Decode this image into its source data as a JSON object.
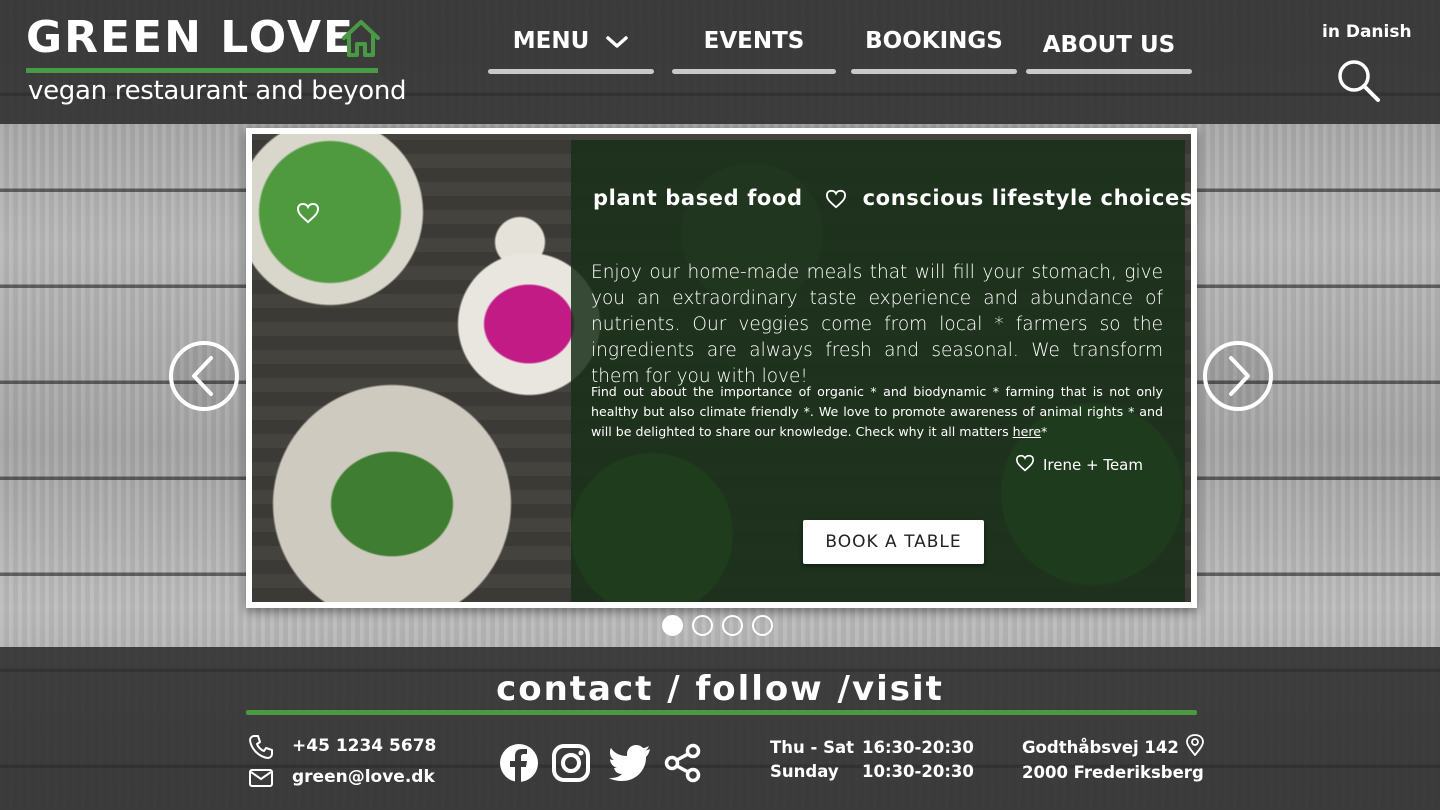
{
  "header": {
    "logo_title": "GREEN LOVE",
    "logo_subtitle": "vegan restaurant and beyond",
    "nav": [
      {
        "label": "MENU"
      },
      {
        "label": "EVENTS"
      },
      {
        "label": "BOOKINGS"
      },
      {
        "label": "ABOUT US"
      }
    ],
    "language_link": "in Danish"
  },
  "slider": {
    "tagline_left": "plant based food",
    "tagline_right": "conscious lifestyle choices",
    "intro": "Enjoy our home-made meals that will fill your stomach, give you an extraordinary taste experience and abundance of nutrients. Our veggies come from local * farmers so the ingredients are always fresh and seasonal. We transform them for you with love!",
    "more_text": "Find out about the importance of organic * and  biodynamic * farming that is not only healthy but also climate friendly *. We love to promote awareness of animal rights * and will be delighted to share our knowledge.  Check why it all matters ",
    "more_link": "here",
    "more_suffix": "*",
    "signature": "Irene + Team",
    "book_button": "BOOK A TABLE",
    "slide_count": 4,
    "active_slide": 1
  },
  "footer": {
    "title": "contact / follow /visit",
    "phone": "+45 1234 5678",
    "email": "green@love.dk",
    "hours": [
      {
        "days": "Thu - Sat",
        "time": "16:30-20:30"
      },
      {
        "days": "Sunday",
        "time": "10:30-20:30"
      }
    ],
    "address_line1": "Godthåbsvej 142",
    "address_line2": "2000 Frederiksberg"
  },
  "colors": {
    "accent_green": "#4a9a44",
    "header_bg": "#2d2d2d",
    "overlay_green": "#183018"
  },
  "icons": [
    "home-icon",
    "chevron-down-icon",
    "search-icon",
    "heart-icon",
    "arrow-left-icon",
    "arrow-right-icon",
    "phone-icon",
    "mail-icon",
    "facebook-icon",
    "instagram-icon",
    "twitter-icon",
    "share-icon",
    "location-pin-icon"
  ]
}
